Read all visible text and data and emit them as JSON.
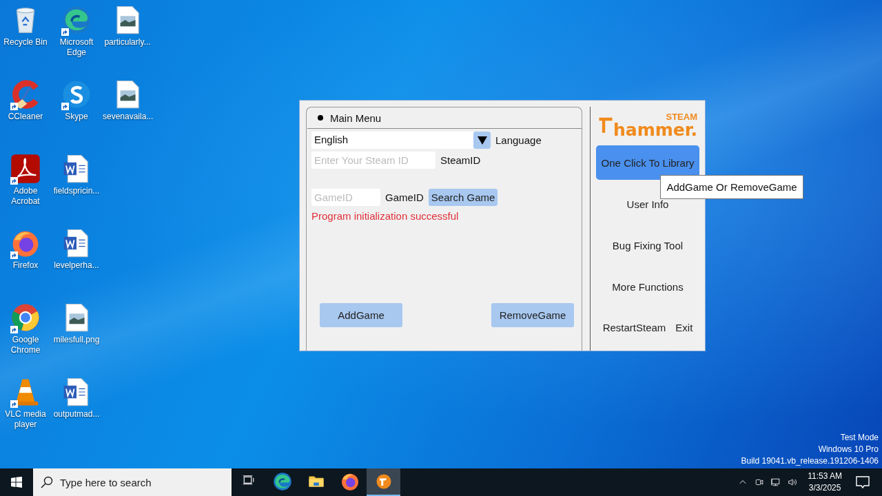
{
  "desktop_icons": [
    {
      "label": "Recycle Bin",
      "kind": "recycle",
      "shortcut": false
    },
    {
      "label": "CCleaner",
      "kind": "ccleaner",
      "shortcut": true
    },
    {
      "label": "Adobe Acrobat",
      "kind": "acrobat",
      "shortcut": true
    },
    {
      "label": "Firefox",
      "kind": "firefox",
      "shortcut": true
    },
    {
      "label": "Google Chrome",
      "kind": "chrome",
      "shortcut": true
    },
    {
      "label": "VLC media player",
      "kind": "vlc",
      "shortcut": true
    },
    {
      "label": "Microsoft Edge",
      "kind": "edge",
      "shortcut": true
    },
    {
      "label": "Skype",
      "kind": "skype",
      "shortcut": true
    },
    {
      "label": "fieldspricin...",
      "kind": "word",
      "shortcut": false
    },
    {
      "label": "levelperha...",
      "kind": "word",
      "shortcut": false
    },
    {
      "label": "milesfull.png",
      "kind": "image",
      "shortcut": false
    },
    {
      "label": "outputmad...",
      "kind": "word",
      "shortcut": false
    },
    {
      "label": "particularly...",
      "kind": "image",
      "shortcut": false
    },
    {
      "label": "sevenavaila...",
      "kind": "image",
      "shortcut": false
    }
  ],
  "app": {
    "group_title": "Main Menu",
    "language": {
      "value": "English",
      "label": "Language"
    },
    "steam_id": {
      "placeholder": "Enter Your Steam ID",
      "label": "SteamID"
    },
    "game_id": {
      "placeholder": "GameID",
      "label": "GameID",
      "button": "Search Game"
    },
    "status": "Program initialization successful",
    "actions": [
      "AddGame",
      "RemoveGame"
    ],
    "logo": {
      "top": "STEAM",
      "main": "hammer."
    },
    "nav": [
      {
        "label": "One Click To Library",
        "selected": true
      },
      {
        "label": "User Info",
        "selected": false
      },
      {
        "label": "Bug Fixing Tool",
        "selected": false
      },
      {
        "label": "More Functions",
        "selected": false
      }
    ],
    "footer_buttons": [
      "RestartSteam",
      "Exit"
    ],
    "tooltip": "AddGame Or RemoveGame"
  },
  "system_watermark": [
    "Test Mode",
    "Windows 10 Pro",
    "Build 19041.vb_release.191206-1406"
  ],
  "taskbar": {
    "search_placeholder": "Type here to search",
    "apps": [
      {
        "kind": "taskview",
        "selected": false
      },
      {
        "kind": "edge",
        "selected": false
      },
      {
        "kind": "folder",
        "selected": false
      },
      {
        "kind": "firefox",
        "selected": false
      },
      {
        "kind": "hammer",
        "selected": true
      }
    ],
    "tray": [
      {
        "kind": "chevron"
      },
      {
        "kind": "meet"
      },
      {
        "kind": "network"
      },
      {
        "kind": "volume"
      }
    ],
    "time": "11:53 AM",
    "date": "3/3/2025"
  }
}
